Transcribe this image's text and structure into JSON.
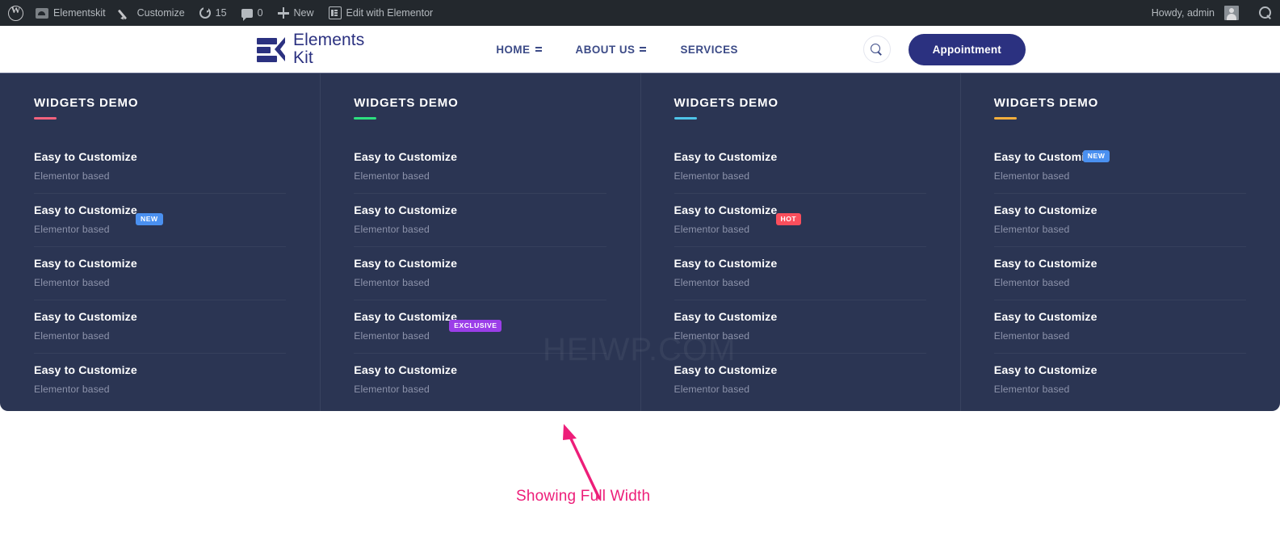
{
  "adminbar": {
    "items": [
      {
        "icon": "wordpress-logo-icon",
        "label": ""
      },
      {
        "icon": "dashboard-icon",
        "label": "Elementskit"
      },
      {
        "icon": "pencil-icon",
        "label": "Customize"
      },
      {
        "icon": "updates-icon",
        "label": "15"
      },
      {
        "icon": "comment-icon",
        "label": "0"
      },
      {
        "icon": "plus-icon",
        "label": "New"
      },
      {
        "icon": "elementor-icon",
        "label": "Edit with Elementor"
      }
    ],
    "howdy": "Howdy, admin",
    "avatar_name": "user-avatar",
    "search_name": "search-icon"
  },
  "header": {
    "logo": {
      "line1": "Elements",
      "line2": "Kit",
      "color": "#2b3180"
    },
    "nav": [
      {
        "label": "HOME",
        "has_dropdown": true
      },
      {
        "label": "ABOUT US",
        "has_dropdown": true
      },
      {
        "label": "SERVICES",
        "has_dropdown": false
      }
    ],
    "search_icon": "search-icon",
    "appointment_label": "Appointment",
    "appointment_color": "#2b3180"
  },
  "mega_menu": {
    "watermark": "HEIWP.COM",
    "background": "#2b3553",
    "columns": [
      {
        "title": "WIDGETS DEMO",
        "accent": "#f2627d",
        "items": [
          {
            "title": "Easy to Customize",
            "subtitle": "Elementor based",
            "badge": null
          },
          {
            "title": "Easy to Customize",
            "subtitle": "Elementor based",
            "badge": {
              "label": "NEW",
              "color": "#4a90f0",
              "position": "pos-side"
            }
          },
          {
            "title": "Easy to Customize",
            "subtitle": "Elementor based",
            "badge": null
          },
          {
            "title": "Easy to Customize",
            "subtitle": "Elementor based",
            "badge": null
          },
          {
            "title": "Easy to Customize",
            "subtitle": "Elementor based",
            "badge": null
          }
        ]
      },
      {
        "title": "WIDGETS DEMO",
        "accent": "#2ddf7f",
        "items": [
          {
            "title": "Easy to Customize",
            "subtitle": "Elementor based",
            "badge": null
          },
          {
            "title": "Easy to Customize",
            "subtitle": "Elementor based",
            "badge": null
          },
          {
            "title": "Easy to Customize",
            "subtitle": "Elementor based",
            "badge": null
          },
          {
            "title": "Easy to Customize",
            "subtitle": "Elementor based",
            "badge": {
              "label": "EXCLUSIVE",
              "color": "#9b3ee8",
              "position": "pos-wide"
            }
          },
          {
            "title": "Easy to Customize",
            "subtitle": "Elementor based",
            "badge": null
          }
        ]
      },
      {
        "title": "WIDGETS DEMO",
        "accent": "#4ec4e8",
        "items": [
          {
            "title": "Easy to Customize",
            "subtitle": "Elementor based",
            "badge": null
          },
          {
            "title": "Easy to Customize",
            "subtitle": "Elementor based",
            "badge": {
              "label": "HOT",
              "color": "#fb4e5c",
              "position": "pos-side"
            }
          },
          {
            "title": "Easy to Customize",
            "subtitle": "Elementor based",
            "badge": null
          },
          {
            "title": "Easy to Customize",
            "subtitle": "Elementor based",
            "badge": null
          },
          {
            "title": "Easy to Customize",
            "subtitle": "Elementor based",
            "badge": null
          }
        ]
      },
      {
        "title": "WIDGETS DEMO",
        "accent": "#f2ae3c",
        "items": [
          {
            "title": "Easy to Customize",
            "subtitle": "Elementor based",
            "badge": {
              "label": "NEW",
              "color": "#4a90f0",
              "position": "pos-inline"
            }
          },
          {
            "title": "Easy to Customize",
            "subtitle": "Elementor based",
            "badge": null
          },
          {
            "title": "Easy to Customize",
            "subtitle": "Elementor based",
            "badge": null
          },
          {
            "title": "Easy to Customize",
            "subtitle": "Elementor based",
            "badge": null
          },
          {
            "title": "Easy to Customize",
            "subtitle": "Elementor based",
            "badge": null
          }
        ]
      }
    ]
  },
  "annotation": {
    "text": "Showing Full Width",
    "color": "#ed1e79"
  }
}
